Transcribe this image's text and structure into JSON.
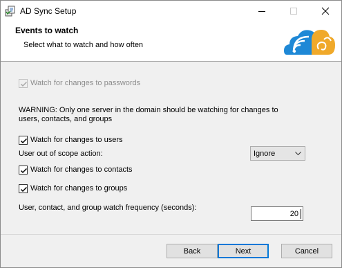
{
  "window": {
    "title": "AD Sync Setup",
    "icon": "installer-icon"
  },
  "banner": {
    "title": "Events to watch",
    "subtitle": "Select what to watch and how often",
    "logo": "cloud-wifi-logo"
  },
  "options": {
    "passwords": {
      "label": "Watch for changes to passwords",
      "checked": true,
      "disabled": true
    },
    "warning": "WARNING: Only one server in the domain should be watching for changes to users, contacts, and groups",
    "users": {
      "label": "Watch for changes to users",
      "checked": true
    },
    "scope_action": {
      "label": "User out of scope action:",
      "value": "Ignore"
    },
    "contacts": {
      "label": "Watch for changes to contacts",
      "checked": true
    },
    "groups": {
      "label": "Watch for changes to groups",
      "checked": true
    },
    "frequency": {
      "label": "User, contact, and group watch frequency (seconds):",
      "value": "20"
    }
  },
  "buttons": {
    "back": "Back",
    "next": "Next",
    "cancel": "Cancel"
  },
  "colors": {
    "accent": "#0078d7",
    "banner_bg": "#ffffff",
    "body_bg": "#f0f0f0"
  }
}
